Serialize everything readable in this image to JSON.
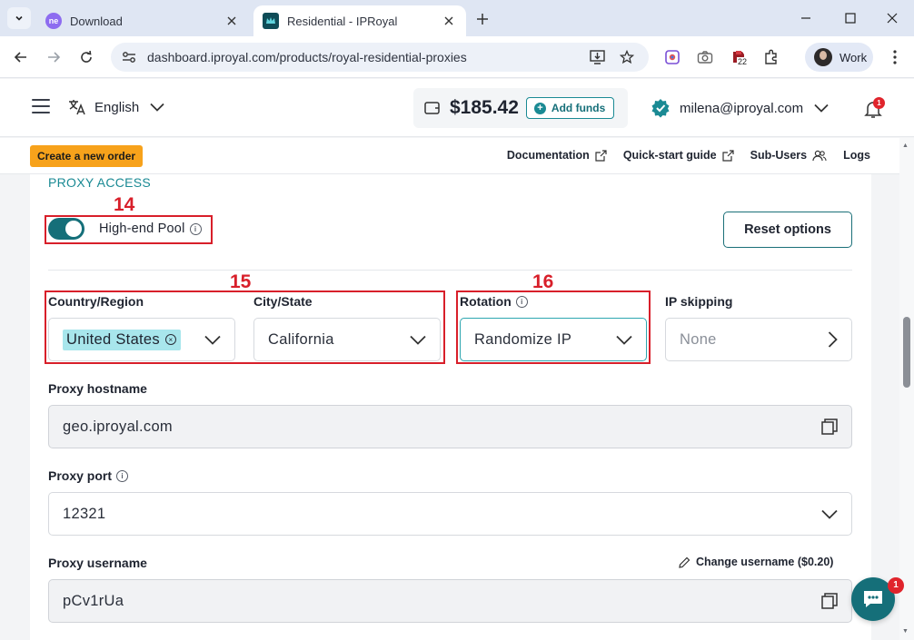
{
  "browser": {
    "tabs": [
      {
        "title": "Download",
        "favicon": "ne-favicon",
        "active": false
      },
      {
        "title": "Residential - IPRoyal",
        "favicon": "iproyal-favicon",
        "active": true
      }
    ],
    "url": "dashboard.iproyal.com/products/royal-residential-proxies",
    "extension_badge": "22",
    "profile_name": "Work"
  },
  "header": {
    "language": "English",
    "balance": "$185.42",
    "add_funds_label": "Add funds",
    "user_email": "milena@iproyal.com",
    "notification_count": "1"
  },
  "subheader": {
    "create_order_label": "Create a new order",
    "links": [
      "Documentation",
      "Quick-start guide",
      "Sub-Users",
      "Logs"
    ]
  },
  "proxy_access": {
    "section_title": "PROXY ACCESS",
    "high_end_pool_label": "High-end Pool",
    "high_end_pool_enabled": true,
    "reset_label": "Reset options",
    "country_label": "Country/Region",
    "country_value": "United States",
    "city_label": "City/State",
    "city_value": "California",
    "rotation_label": "Rotation",
    "rotation_value": "Randomize IP",
    "ip_skipping_label": "IP skipping",
    "ip_skipping_value": "None",
    "hostname_label": "Proxy hostname",
    "hostname_value": "geo.iproyal.com",
    "port_label": "Proxy port",
    "port_value": "12321",
    "username_label": "Proxy username",
    "username_value": "pCv1rUa",
    "change_username_label": "Change username ($0.20)"
  },
  "annotations": [
    "14",
    "15",
    "16"
  ],
  "chat_badge": "1",
  "colors": {
    "accent": "#156f79",
    "accent_light": "#1a8a94",
    "chip": "#a8e6ec",
    "create_button": "#f7a21b",
    "annotation": "#d81f2a"
  }
}
